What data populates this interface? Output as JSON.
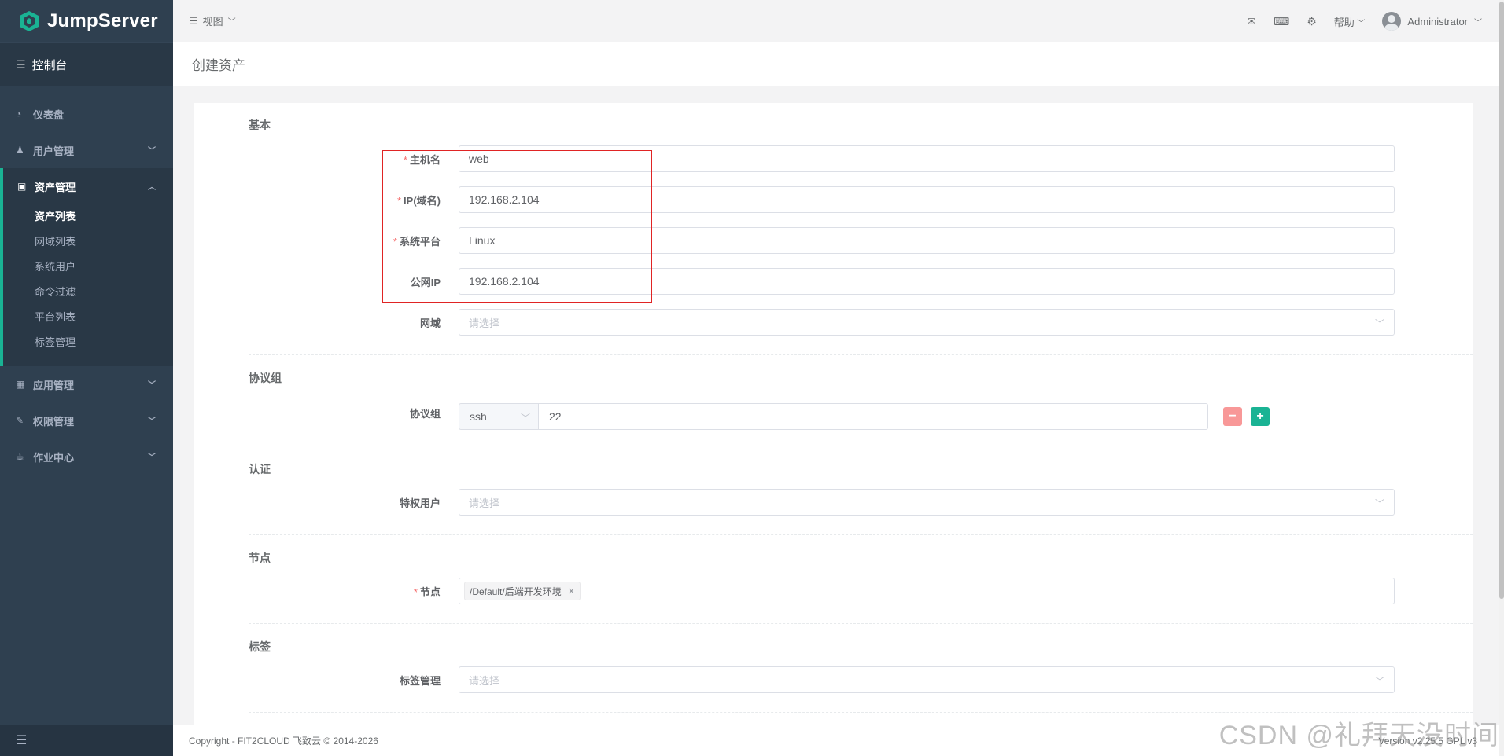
{
  "app": {
    "logo": "JumpServer"
  },
  "sidebar": {
    "console": "控制台",
    "items": [
      {
        "label": "仪表盘",
        "icon": "dashboard-icon"
      },
      {
        "label": "用户管理",
        "icon": "users-icon"
      },
      {
        "label": "资产管理",
        "icon": "inbox-icon"
      },
      {
        "label": "应用管理",
        "icon": "grid-icon"
      },
      {
        "label": "权限管理",
        "icon": "edit-icon"
      },
      {
        "label": "作业中心",
        "icon": "coffee-icon"
      }
    ],
    "sub_items": [
      "资产列表",
      "网域列表",
      "系统用户",
      "命令过滤",
      "平台列表",
      "标签管理"
    ]
  },
  "topbar": {
    "view": "视图",
    "help": "帮助",
    "user": "Administrator"
  },
  "page": {
    "title": "创建资产"
  },
  "form": {
    "sections": {
      "basic": "基本",
      "protocols": "协议组",
      "auth": "认证",
      "node": "节点",
      "labels": "标签"
    },
    "hostname": {
      "label": "主机名",
      "value": "web"
    },
    "ip": {
      "label": "IP(域名)",
      "value": "192.168.2.104"
    },
    "platform": {
      "label": "系统平台",
      "value": "Linux"
    },
    "public_ip": {
      "label": "公网IP",
      "value": "192.168.2.104"
    },
    "domain": {
      "label": "网域",
      "placeholder": "请选择"
    },
    "protocol": {
      "label": "协议组",
      "name": "ssh",
      "port": "22"
    },
    "admin_user": {
      "label": "特权用户",
      "placeholder": "请选择"
    },
    "nodes": {
      "label": "节点",
      "tag": "/Default/后端开发环境"
    },
    "label_mgmt": {
      "label": "标签管理",
      "placeholder": "请选择"
    }
  },
  "footer": {
    "copyright": "Copyright - FIT2CLOUD 飞致云 © 2014-2026",
    "version": "Version v2.25.5 GPL v3"
  },
  "watermark": "CSDN @礼拜天没时间",
  "colors": {
    "sidebar": "#2f4050",
    "accent": "#1ab394",
    "required": "#f56c6c",
    "highlight": "#e02424"
  }
}
